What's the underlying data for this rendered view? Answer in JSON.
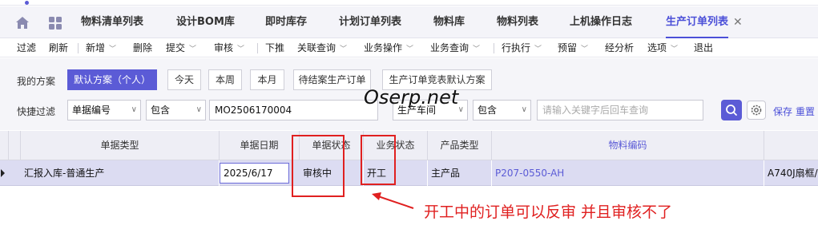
{
  "tabs": {
    "items": [
      "物料清单列表",
      "设计BOM库",
      "即时库存",
      "计划订单列表",
      "物料库",
      "物料列表",
      "上机操作日志",
      "生产订单列表"
    ],
    "active_close": "✕"
  },
  "toolbar": {
    "filter": "过滤",
    "refresh": "刷新",
    "add": "新增",
    "delete": "删除",
    "submit": "提交",
    "audit": "审核",
    "push_down": "下推",
    "related_query": "关联查询",
    "business_ops": "业务操作",
    "business_query": "业务查询",
    "row_execute": "行执行",
    "warning": "预留",
    "analysis": "经分析",
    "options": "选项",
    "exit": "退出"
  },
  "filter": {
    "my_scheme_label": "我的方案",
    "schemes": [
      "默认方案（个人）",
      "今天",
      "本周",
      "本月",
      "待结案生产订单",
      "生产订单竞表默认方案"
    ],
    "quick_filter_label": "快捷过滤",
    "field1": "单据编号",
    "op1": "包含",
    "value1": "MO2506170004",
    "field2": "生产车间",
    "op2": "包含",
    "keyword_placeholder": "请输入关键字后回车查询",
    "save": "保存",
    "reset": "重置"
  },
  "watermark": "Oserp.net",
  "grid": {
    "columns": [
      "单据类型",
      "单据日期",
      "单据状态",
      "业务状态",
      "产品类型",
      "物料编码"
    ],
    "row": {
      "doc_type": "汇报入库-普通生产",
      "date": "2025/6/17",
      "doc_status": "审核中",
      "biz_status": "开工",
      "product_type": "主产品",
      "material_code": "P207-0550-AH",
      "material_name": "A740J扇框/"
    }
  },
  "annotation": "开工中的订单可以反审   并且审核不了",
  "colors": {
    "accent": "#5b5bd6",
    "annotation_red": "#e02020"
  }
}
